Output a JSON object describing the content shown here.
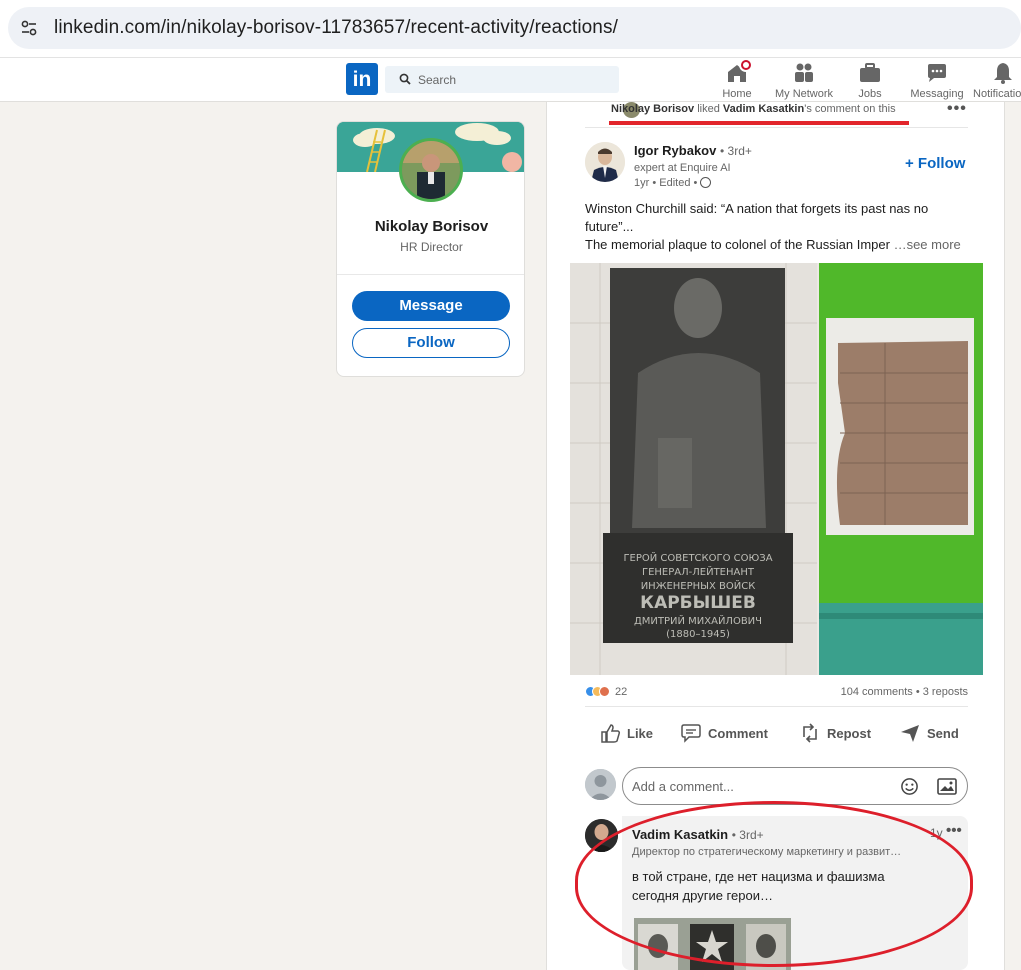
{
  "browser": {
    "url": "linkedin.com/in/nikolay-borisov-11783657/recent-activity/reactions/"
  },
  "nav": {
    "logo": "in",
    "search_placeholder": "Search",
    "items": [
      {
        "label": "Home",
        "icon": "home-icon"
      },
      {
        "label": "My Network",
        "icon": "people-icon"
      },
      {
        "label": "Jobs",
        "icon": "briefcase-icon"
      },
      {
        "label": "Messaging",
        "icon": "chat-icon"
      },
      {
        "label": "Notifications",
        "icon": "bell-icon"
      }
    ]
  },
  "profile": {
    "name": "Nikolay Borisov",
    "title": "HR Director",
    "message_label": "Message",
    "follow_label": "Follow"
  },
  "feed": {
    "activity": {
      "actor": "Nikolay Borisov",
      "verb": "liked",
      "target": "Vadim Kasatkin",
      "suffix": "'s comment on this"
    },
    "post": {
      "author": "Igor Rybakov",
      "degree": "• 3rd+",
      "headline": "expert at Enquire AI",
      "time": "1yr • Edited •",
      "follow_label": "+ Follow",
      "text_line1": "Winston Churchill said: “A nation that forgets its past nas no future”...",
      "text_line2": "The memorial plaque to colonel of the Russian Imper",
      "see_more": "…see more",
      "plaque_text": [
        "ГЕРОЙ СОВЕТСКОГО СОЮЗА",
        "ГЕНЕРАЛ-ЛЕЙТЕНАНТ",
        "ИНЖЕНЕРНЫХ ВОЙСК",
        "КАРБЫШЕВ",
        "ДМИТРИЙ МИХАЙЛОВИЧ",
        "(1880–1945)"
      ],
      "reactions_count": "22",
      "comments_reposts": "104 comments • 3 reposts"
    },
    "actions": {
      "like": "Like",
      "comment": "Comment",
      "repost": "Repost",
      "send": "Send"
    },
    "comment_input_placeholder": "Add a comment...",
    "comment": {
      "author": "Vadim Kasatkin",
      "degree": "• 3rd+",
      "time": "1y",
      "headline": "Директор по стратегическому маркетингу и развит…",
      "text": "в той стране, где нет нацизма и фашизма сегодня другие герои…"
    }
  },
  "colors": {
    "brand": "#0a66c2",
    "annotation_red": "#dd1f2b",
    "page_bg": "#f4f2ee"
  }
}
